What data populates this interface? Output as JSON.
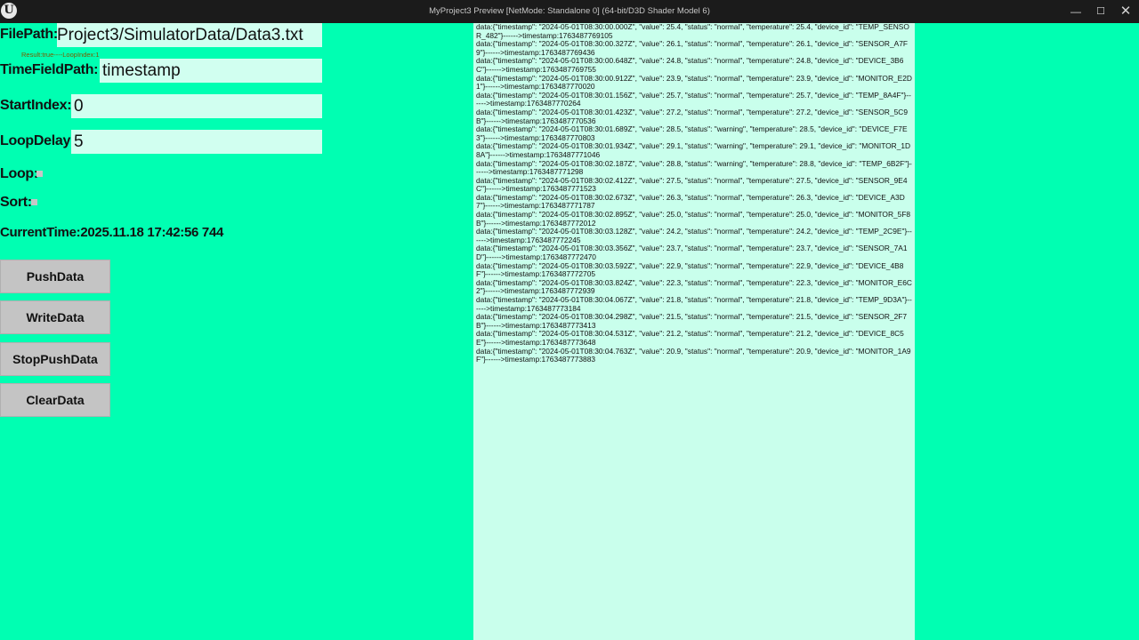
{
  "window": {
    "title": "MyProject3 Preview [NetMode: Standalone 0]  (64-bit/D3D Shader Model 6)",
    "logo": "U",
    "minimize_icon": "—",
    "maximize_icon": "☐",
    "close_icon": "✕"
  },
  "form": {
    "file_path_label": "FilePath:",
    "file_path_value": "Project3/SimulatorData/Data3.txt",
    "result_text": "Result:true----LoopIndex:1",
    "time_field_label": "TimeFieldPath:",
    "time_field_value": "timestamp",
    "start_index_label": "StartIndex:",
    "start_index_value": "0",
    "loop_delay_label": "LoopDelay:",
    "loop_delay_value": "5",
    "loop_label": "Loop:",
    "loop_checked": false,
    "sort_label": "Sort:",
    "sort_checked": false,
    "current_time_label": "CurrentTime:",
    "current_time_value": "2025.11.18 17:42:56 744"
  },
  "buttons": {
    "push": "PushData",
    "write": "WriteData",
    "stop": "StopPushData",
    "clear": "ClearData"
  },
  "log": [
    "data:{\"timestamp\": \"2024-05-01T08:30:00.000Z\", \"value\": 25.4, \"status\": \"normal\", \"temperature\": 25.4, \"device_id\": \"TEMP_SENSOR_482\"}------>timestamp:1763487769105",
    "data:{\"timestamp\": \"2024-05-01T08:30:00.327Z\", \"value\": 26.1, \"status\": \"normal\", \"temperature\": 26.1, \"device_id\": \"SENSOR_A7F9\"}------>timestamp:1763487769436",
    "data:{\"timestamp\": \"2024-05-01T08:30:00.648Z\", \"value\": 24.8, \"status\": \"normal\", \"temperature\": 24.8, \"device_id\": \"DEVICE_3B6C\"}------>timestamp:1763487769755",
    "data:{\"timestamp\": \"2024-05-01T08:30:00.912Z\", \"value\": 23.9, \"status\": \"normal\", \"temperature\": 23.9, \"device_id\": \"MONITOR_E2D1\"}------>timestamp:1763487770020",
    "data:{\"timestamp\": \"2024-05-01T08:30:01.156Z\", \"value\": 25.7, \"status\": \"normal\", \"temperature\": 25.7, \"device_id\": \"TEMP_8A4F\"}------>timestamp:1763487770264",
    "data:{\"timestamp\": \"2024-05-01T08:30:01.423Z\", \"value\": 27.2, \"status\": \"normal\", \"temperature\": 27.2, \"device_id\": \"SENSOR_5C9B\"}------>timestamp:1763487770536",
    "data:{\"timestamp\": \"2024-05-01T08:30:01.689Z\", \"value\": 28.5, \"status\": \"warning\", \"temperature\": 28.5, \"device_id\": \"DEVICE_F7E3\"}------>timestamp:1763487770803",
    "data:{\"timestamp\": \"2024-05-01T08:30:01.934Z\", \"value\": 29.1, \"status\": \"warning\", \"temperature\": 29.1, \"device_id\": \"MONITOR_1D8A\"}------>timestamp:1763487771046",
    "data:{\"timestamp\": \"2024-05-01T08:30:02.187Z\", \"value\": 28.8, \"status\": \"warning\", \"temperature\": 28.8, \"device_id\": \"TEMP_6B2F\"}------>timestamp:1763487771298",
    "data:{\"timestamp\": \"2024-05-01T08:30:02.412Z\", \"value\": 27.5, \"status\": \"normal\", \"temperature\": 27.5, \"device_id\": \"SENSOR_9E4C\"}------>timestamp:1763487771523",
    "data:{\"timestamp\": \"2024-05-01T08:30:02.673Z\", \"value\": 26.3, \"status\": \"normal\", \"temperature\": 26.3, \"device_id\": \"DEVICE_A3D7\"}------>timestamp:1763487771787",
    "data:{\"timestamp\": \"2024-05-01T08:30:02.895Z\", \"value\": 25.0, \"status\": \"normal\", \"temperature\": 25.0, \"device_id\": \"MONITOR_5F8B\"}------>timestamp:1763487772012",
    "data:{\"timestamp\": \"2024-05-01T08:30:03.128Z\", \"value\": 24.2, \"status\": \"normal\", \"temperature\": 24.2, \"device_id\": \"TEMP_2C9E\"}------>timestamp:1763487772245",
    "data:{\"timestamp\": \"2024-05-01T08:30:03.356Z\", \"value\": 23.7, \"status\": \"normal\", \"temperature\": 23.7, \"device_id\": \"SENSOR_7A1D\"}------>timestamp:1763487772470",
    "data:{\"timestamp\": \"2024-05-01T08:30:03.592Z\", \"value\": 22.9, \"status\": \"normal\", \"temperature\": 22.9, \"device_id\": \"DEVICE_4B8F\"}------>timestamp:1763487772705",
    "data:{\"timestamp\": \"2024-05-01T08:30:03.824Z\", \"value\": 22.3, \"status\": \"normal\", \"temperature\": 22.3, \"device_id\": \"MONITOR_E6C2\"}------>timestamp:1763487772939",
    "data:{\"timestamp\": \"2024-05-01T08:30:04.067Z\", \"value\": 21.8, \"status\": \"normal\", \"temperature\": 21.8, \"device_id\": \"TEMP_9D3A\"}------>timestamp:1763487773184",
    "data:{\"timestamp\": \"2024-05-01T08:30:04.298Z\", \"value\": 21.5, \"status\": \"normal\", \"temperature\": 21.5, \"device_id\": \"SENSOR_2F7B\"}------>timestamp:1763487773413",
    "data:{\"timestamp\": \"2024-05-01T08:30:04.531Z\", \"value\": 21.2, \"status\": \"normal\", \"temperature\": 21.2, \"device_id\": \"DEVICE_8C5E\"}------>timestamp:1763487773648",
    "data:{\"timestamp\": \"2024-05-01T08:30:04.763Z\", \"value\": 20.9, \"status\": \"normal\", \"temperature\": 20.9, \"device_id\": \"MONITOR_1A9F\"}------>timestamp:1763487773883"
  ]
}
